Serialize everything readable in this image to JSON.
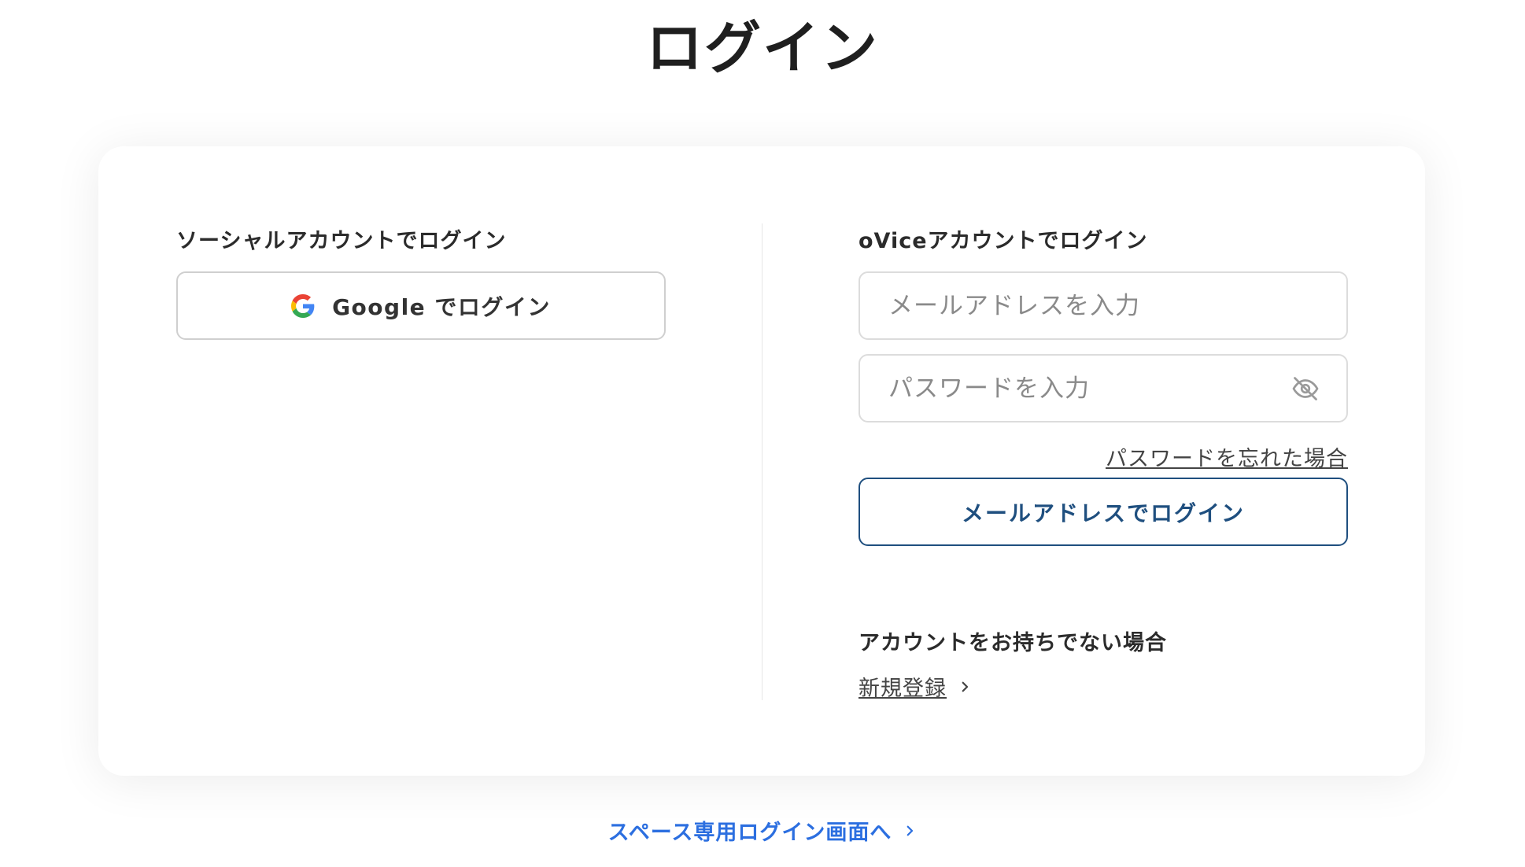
{
  "page": {
    "title": "ログイン"
  },
  "social": {
    "heading": "ソーシャルアカウントでログイン",
    "google_button_label": "Google でログイン"
  },
  "ovice": {
    "heading": "oViceアカウントでログイン",
    "email_placeholder": "メールアドレスを入力",
    "email_value": "",
    "password_placeholder": "パスワードを入力",
    "password_value": "",
    "forgot_password": "パスワードを忘れた場合",
    "email_login_button": "メールアドレスでログイン"
  },
  "register": {
    "heading": "アカウントをお持ちでない場合",
    "link_label": "新規登録"
  },
  "footer": {
    "space_login_link": "スペース専用ログイン画面へ"
  },
  "colors": {
    "primary_dark": "#1f4f7f",
    "link_blue": "#2c6fe0",
    "google_blue": "#4285F4",
    "google_red": "#EA4335",
    "google_yellow": "#FBBC05",
    "google_green": "#34A853"
  },
  "icons": {
    "google": "google-logo-icon",
    "password_visibility": "eye-off-icon",
    "chevron": "chevron-right-icon"
  }
}
